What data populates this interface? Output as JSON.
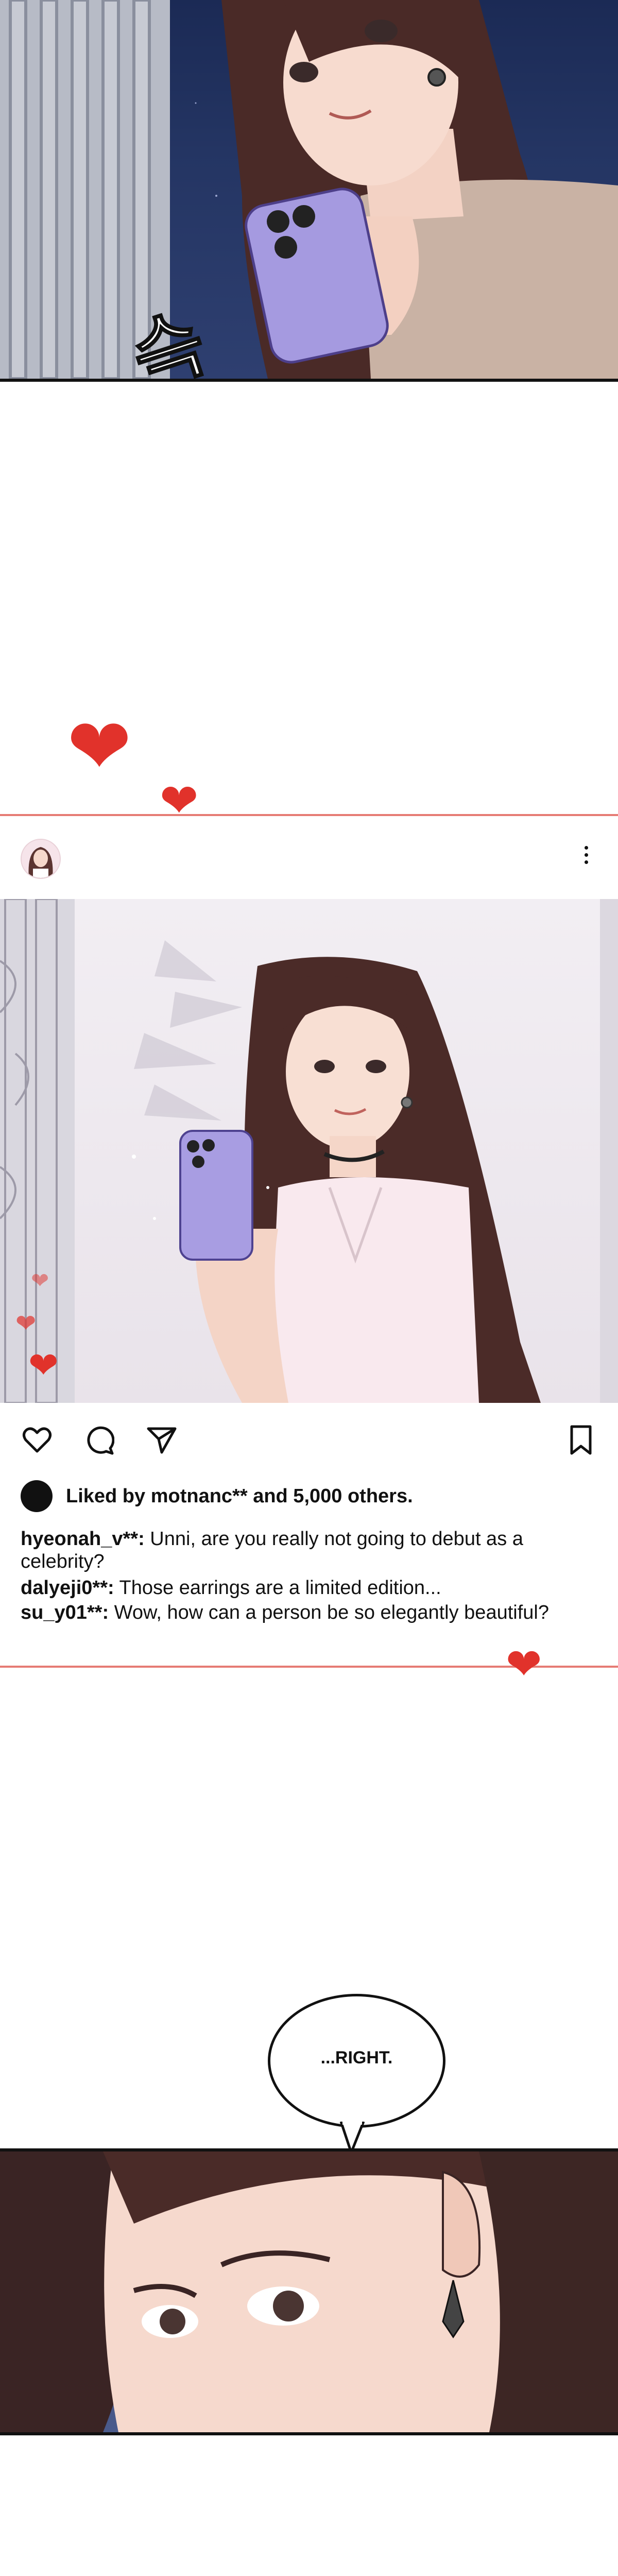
{
  "sfx": "슥",
  "post": {
    "liked_by": "Liked by motnanc** and 5,000 others.",
    "comments": [
      {
        "user": "hyeonah_v**:",
        "text": " Unni, are you really not going to debut as a celebrity?"
      },
      {
        "user": "dalyeji0**:",
        "text": " Those earrings are a limited edition..."
      },
      {
        "user": "su_y01**:",
        "text": " Wow, how can a person be so elegantly beautiful?"
      }
    ]
  },
  "bubble": {
    "text": "...RIGHT."
  },
  "icons": {
    "like": "heart-outline-icon",
    "comment": "comment-bubble-icon",
    "share": "paper-plane-icon",
    "save": "bookmark-icon",
    "more": "vertical-dots-icon"
  },
  "colors": {
    "accent_red": "#e1322b",
    "divider_pink": "#e67b74",
    "night_blue": "#243563"
  }
}
